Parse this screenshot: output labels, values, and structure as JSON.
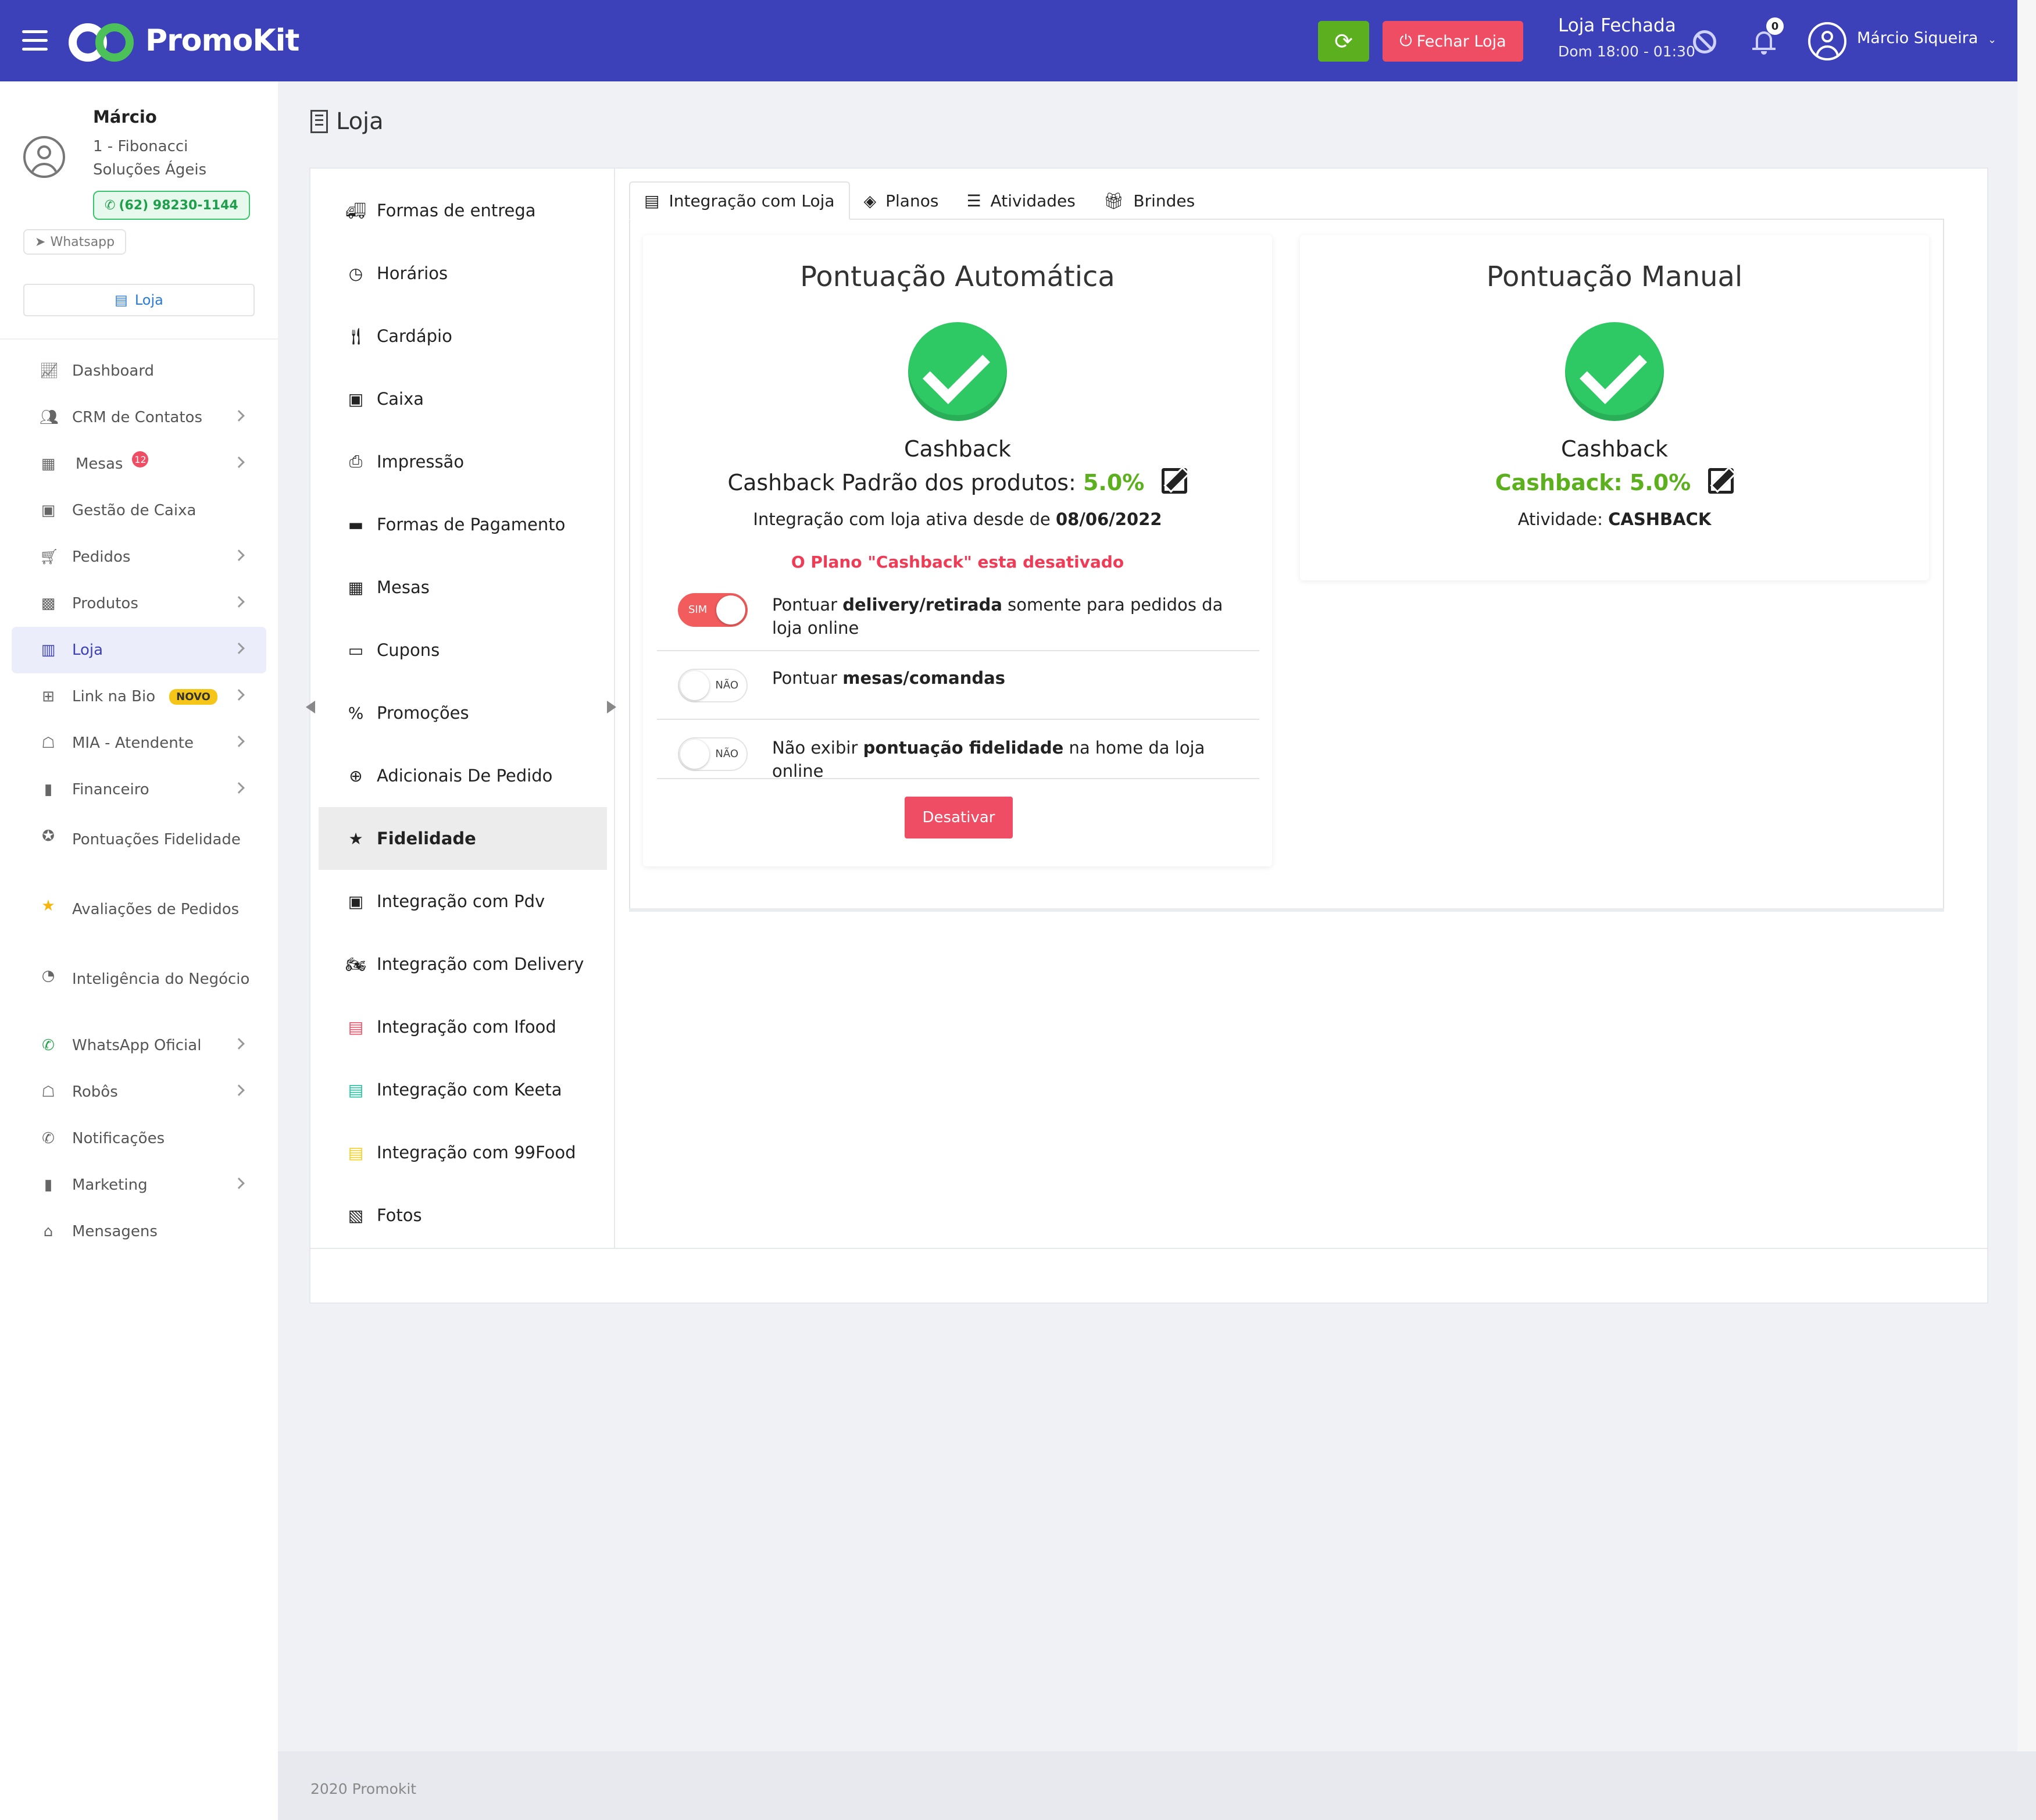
{
  "topbar": {
    "brand": "PromoKit",
    "close_store_label": "Fechar Loja",
    "store_status": "Loja Fechada",
    "store_hours": "Dom 18:00 - 01:30",
    "notifications_count": "0",
    "user_name": "Márcio Siqueira",
    "colors": {
      "bar": "#3c41b9",
      "refresh": "#5cb020",
      "close": "#ef4d64"
    }
  },
  "sidebar": {
    "user_name": "Márcio",
    "org": "1 - Fibonacci Soluções Ágeis",
    "phone": "(62) 98230-1144",
    "whatsapp_label": "Whatsapp",
    "store_label": "Loja",
    "items": [
      {
        "label": "Dashboard",
        "icon": "chart-line-icon"
      },
      {
        "label": "CRM de Contatos",
        "icon": "users-icon"
      },
      {
        "label": "Mesas",
        "icon": "table-icon",
        "badge": "12"
      },
      {
        "label": "Gestão de Caixa",
        "icon": "cash-register-icon"
      },
      {
        "label": "Pedidos",
        "icon": "cart-icon"
      },
      {
        "label": "Produtos",
        "icon": "box-icon"
      },
      {
        "label": "Loja",
        "icon": "building-icon"
      },
      {
        "label": "Link na Bio",
        "icon": "sitemap-icon",
        "badge": "NOVO"
      },
      {
        "label": "MIA - Atendente",
        "icon": "robot-icon"
      },
      {
        "label": "Financeiro",
        "icon": "bar-chart-icon"
      },
      {
        "label": "Pontuações Fidelidade",
        "icon": "medal-icon"
      },
      {
        "label": "Avaliações de Pedidos",
        "icon": "star-icon"
      },
      {
        "label": "Inteligência do Negócio",
        "icon": "pie-chart-icon"
      },
      {
        "label": "WhatsApp Oficial",
        "icon": "whatsapp-icon"
      },
      {
        "label": "Robôs",
        "icon": "robot-icon"
      },
      {
        "label": "Notificações",
        "icon": "whatsapp-icon"
      },
      {
        "label": "Marketing",
        "icon": "bar-chart-icon"
      },
      {
        "label": "Mensagens",
        "icon": "inbox-icon"
      }
    ]
  },
  "page": {
    "title": "Loja"
  },
  "left_menu": [
    "Formas de entrega",
    "Horários",
    "Cardápio",
    "Caixa",
    "Impressão",
    "Formas de Pagamento",
    "Mesas",
    "Cupons",
    "Promoções",
    "Adicionais De Pedido",
    "Fidelidade",
    "Integração com Pdv",
    "Integração com Delivery",
    "Integração com Ifood",
    "Integração com Keeta",
    "Integração com 99Food",
    "Fotos"
  ],
  "tabs": [
    "Integração com Loja",
    "Planos",
    "Atividades",
    "Brindes"
  ],
  "auto": {
    "title": "Pontuação Automática",
    "plan": "Cashback",
    "default_prefix": "Cashback Padrão dos produtos:",
    "default_value": "5.0%",
    "since_prefix": "Integração com loja ativa desde de",
    "since_date": "08/06/2022",
    "warning": "O Plano \"Cashback\" esta desativado",
    "toggles": [
      {
        "state": "SIM",
        "pre": "Pontuar ",
        "bold": "delivery/retirada",
        "post": " somente para pedidos da loja online"
      },
      {
        "state": "NÃO",
        "pre": "Pontuar ",
        "bold": "mesas/comandas",
        "post": ""
      },
      {
        "state": "NÃO",
        "pre": "Não exibir ",
        "bold": "pontuação fidelidade",
        "post": " na home da loja online"
      }
    ],
    "deactivate_label": "Desativar"
  },
  "manual": {
    "title": "Pontuação Manual",
    "plan": "Cashback",
    "cashback_prefix": "Cashback:",
    "cashback_value": "5.0%",
    "activity_prefix": "Atividade:",
    "activity_value": "CASHBACK"
  },
  "footer": {
    "text": "2020 Promokit"
  }
}
